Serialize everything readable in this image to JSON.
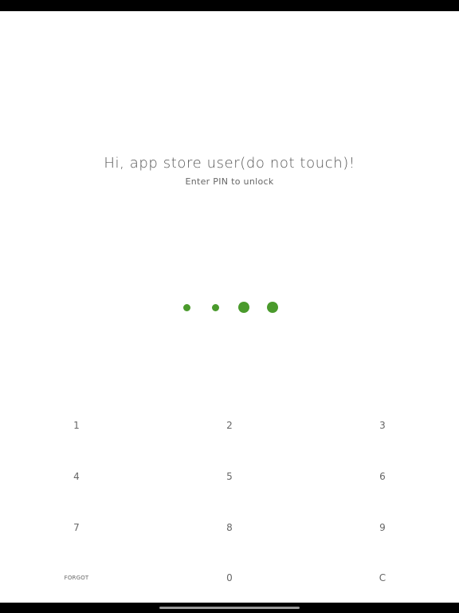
{
  "lock_screen": {
    "greeting": "Hi, app store user(do not touch)!",
    "subtitle": "Enter PIN to unlock",
    "pin": {
      "length": 4,
      "entered": 2,
      "accent_color": "#4a9a2c"
    }
  },
  "keypad": {
    "keys": [
      "1",
      "2",
      "3",
      "4",
      "5",
      "6",
      "7",
      "8",
      "9",
      "FORGOT",
      "0",
      "C"
    ]
  }
}
